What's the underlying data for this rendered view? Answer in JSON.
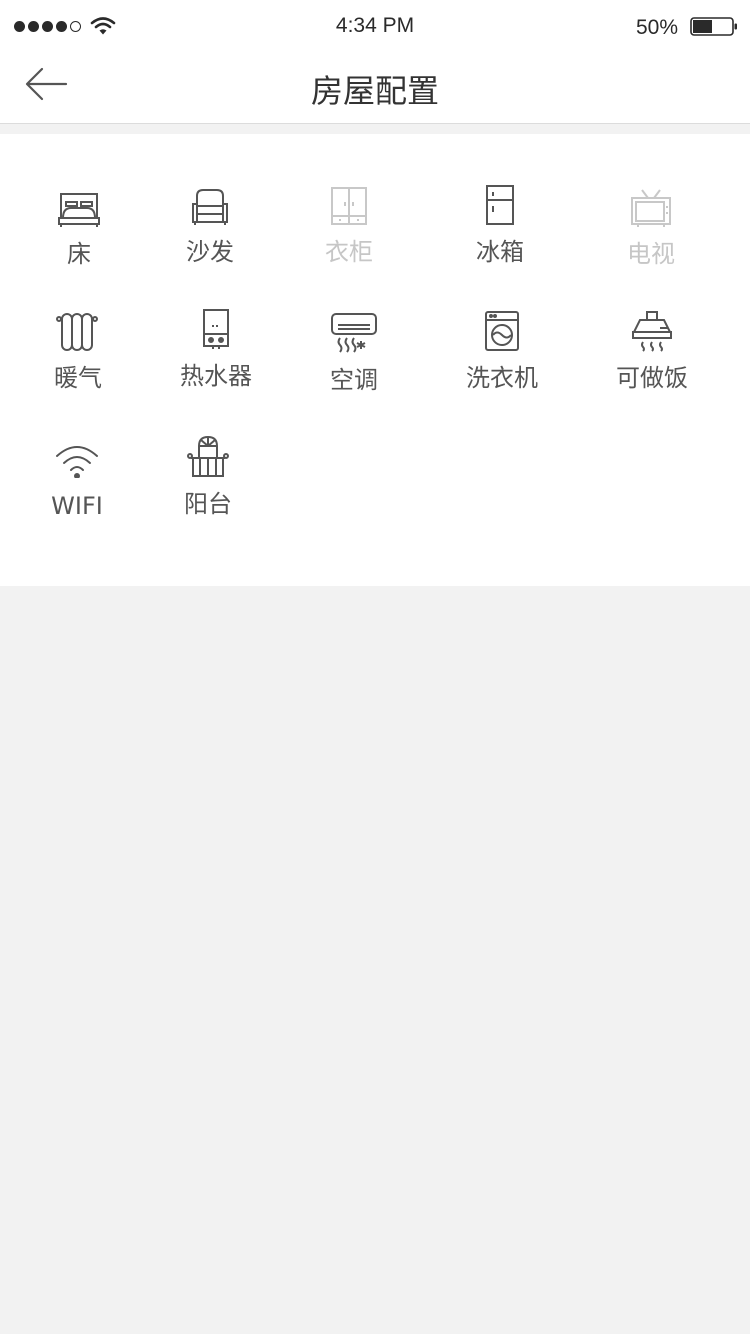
{
  "status_bar": {
    "time": "4:34 PM",
    "battery_percent": "50%",
    "battery_level": 0.5,
    "signal_bars_filled": 4,
    "signal_bars_total": 5
  },
  "nav": {
    "title": "房屋配置",
    "back_icon": "arrow-left-icon"
  },
  "colors": {
    "available": "#555555",
    "unavailable": "#c8c8c8",
    "background": "#f2f2f2"
  },
  "facilities": [
    {
      "label": "床",
      "icon": "bed-icon",
      "available": true
    },
    {
      "label": "沙发",
      "icon": "sofa-icon",
      "available": true
    },
    {
      "label": "衣柜",
      "icon": "wardrobe-icon",
      "available": false
    },
    {
      "label": "冰箱",
      "icon": "fridge-icon",
      "available": true
    },
    {
      "label": "电视",
      "icon": "tv-icon",
      "available": false
    },
    {
      "label": "暖气",
      "icon": "radiator-icon",
      "available": true
    },
    {
      "label": "热水器",
      "icon": "water-heater-icon",
      "available": true
    },
    {
      "label": "空调",
      "icon": "air-conditioner-icon",
      "available": true
    },
    {
      "label": "洗衣机",
      "icon": "washing-machine-icon",
      "available": true
    },
    {
      "label": "可做饭",
      "icon": "range-hood-icon",
      "available": true
    },
    {
      "label": "WIFI",
      "icon": "wifi-icon",
      "available": true
    },
    {
      "label": "阳台",
      "icon": "balcony-icon",
      "available": true
    }
  ]
}
